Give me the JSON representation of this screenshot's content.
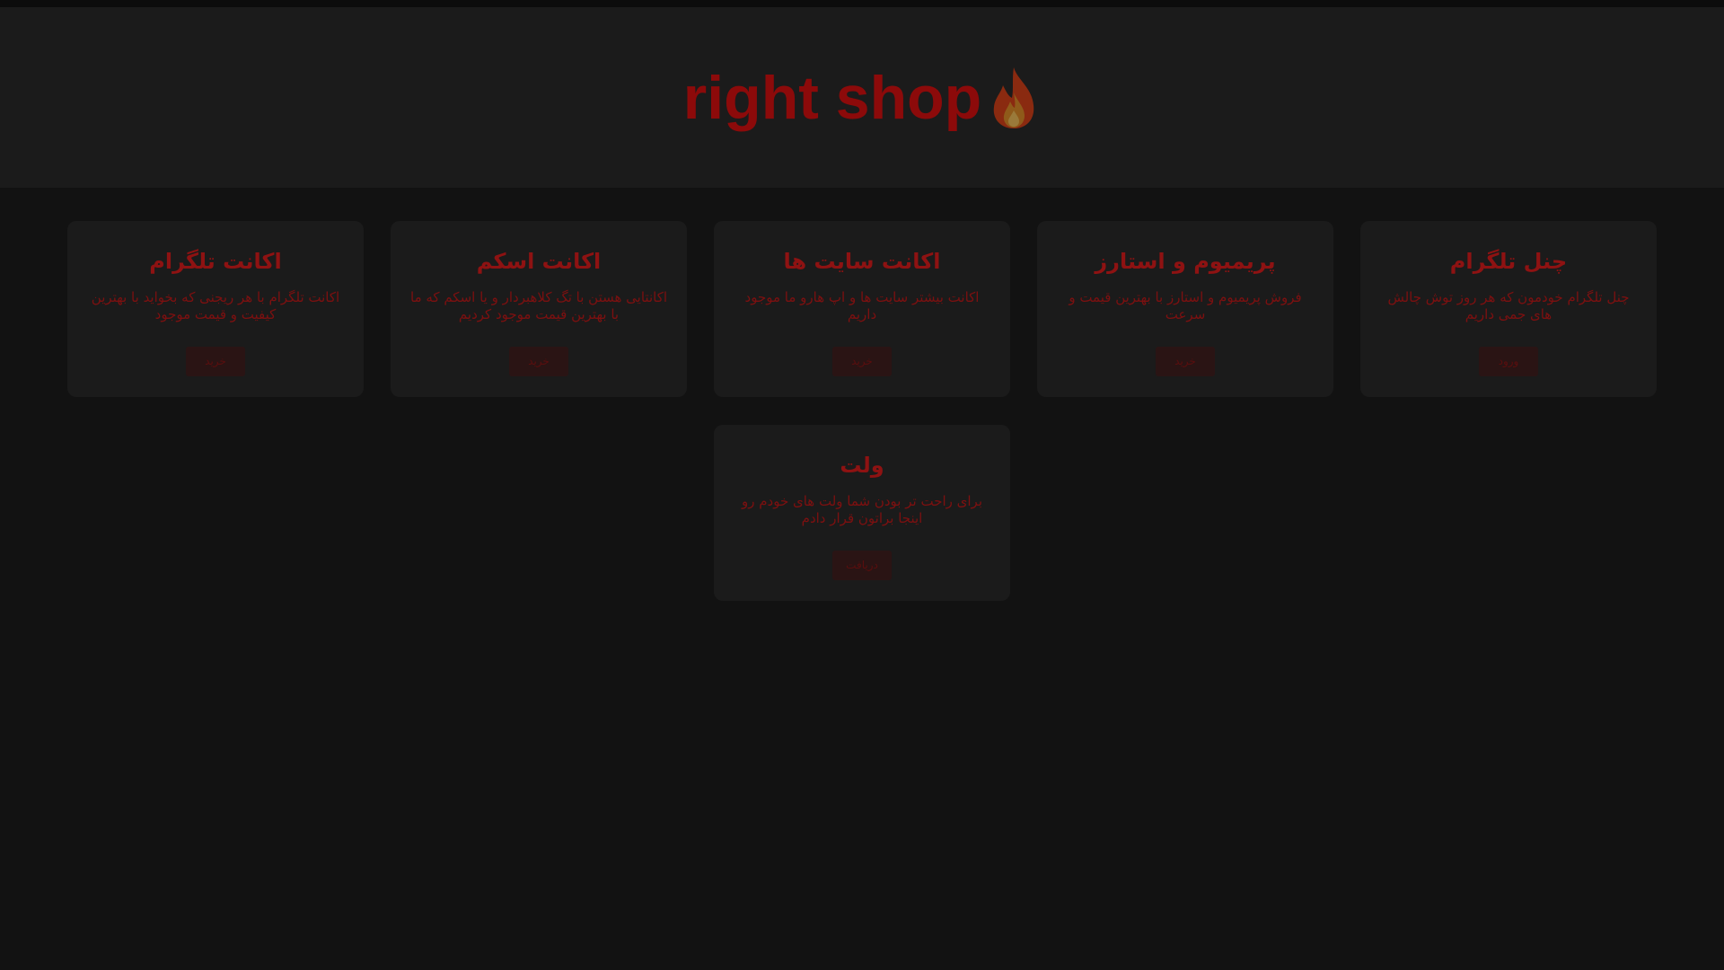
{
  "header": {
    "title": "right shop",
    "icon": "fire-icon"
  },
  "colors": {
    "background": "#121212",
    "header_background": "#1b1b1b",
    "card_background": "#1b1b1b",
    "accent": "#8c0a0a",
    "button_background": "#2a1414"
  },
  "cards": [
    {
      "title": "چنل تلگرام",
      "description": "چنل تلگرام خودمون که هر روز توش چالش های جمی داریم",
      "button": "ورود"
    },
    {
      "title": "پریمیوم و استارز",
      "description": "فروش پریمیوم و استارز با بهترین قیمت و سرعت",
      "button": "خرید"
    },
    {
      "title": "اکانت سایت ها",
      "description": "اکانت بیشتر سایت ها و اپ هارو ما موجود داریم",
      "button": "خرید"
    },
    {
      "title": "اکانت اسکم",
      "description": "اکانتایی هستن با تگ کلاهبردار و یا اسکم که ما با بهترین قیمت موجود کردیم",
      "button": "خرید"
    },
    {
      "title": "اکانت تلگرام",
      "description": "اکانت تلگرام با هر ریجنی که بخواید با بهترین کیفیت و قیمت موجود",
      "button": "خرید"
    },
    {
      "title": "ولت",
      "description": "برای راحت تر بودن شما ولت های خودم رو اینجا براتون قرار دادم",
      "button": "دریافت"
    }
  ]
}
